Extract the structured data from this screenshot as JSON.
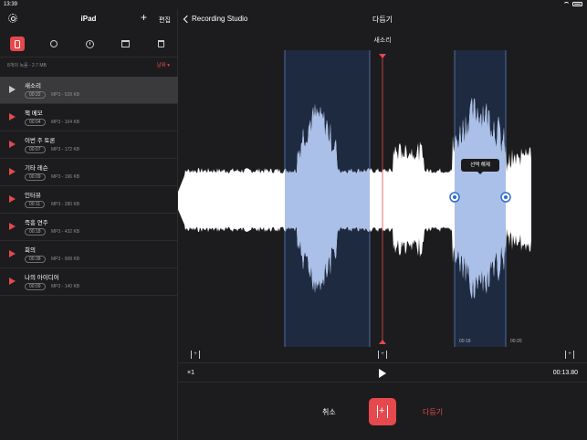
{
  "status_bar": {
    "time": "13:39"
  },
  "sidebar": {
    "title": "iPad",
    "edit_label": "편집",
    "count_label": "8개의 녹음 - 2.7 MB",
    "sort_label": "날짜 ▾",
    "recordings": [
      {
        "name": "새소리",
        "duration": "00:22",
        "meta": "MP3 - 528 KB",
        "selected": true
      },
      {
        "name": "책 메모",
        "duration": "00:04",
        "meta": "MP3 - 104 KB"
      },
      {
        "name": "이번 주 토론",
        "duration": "00:07",
        "meta": "MP3 - 172 KB"
      },
      {
        "name": "기타 레슨",
        "duration": "00:09",
        "meta": "MP3 - 196 KB"
      },
      {
        "name": "인터뷰",
        "duration": "00:11",
        "meta": "MP3 - 280 KB"
      },
      {
        "name": "즉흥 연주",
        "duration": "00:18",
        "meta": "MP3 - 432 KB"
      },
      {
        "name": "회의",
        "duration": "00:38",
        "meta": "MP3 - 908 KB"
      },
      {
        "name": "나의 아이디어",
        "duration": "00:09",
        "meta": "MP3 - 140 KB"
      }
    ]
  },
  "nav": {
    "back_label": "Recording Studio",
    "title": "다듬기"
  },
  "editor": {
    "recording_title": "새소리",
    "tooltip": "선택 해제",
    "time_marks": [
      "00:18",
      "00:20"
    ],
    "speed": "×1",
    "duration": "00:13.80"
  },
  "actions": {
    "cancel_label": "취소",
    "trim_label": "다듬기"
  },
  "colors": {
    "accent": "#e5484d",
    "selection": "#aac0e8",
    "background": "#1c1c1e"
  }
}
